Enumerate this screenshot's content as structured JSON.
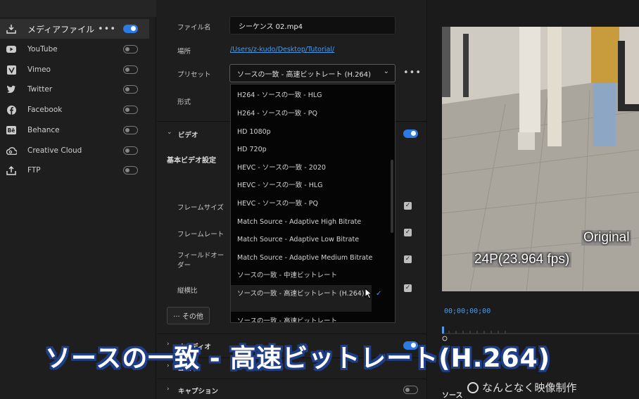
{
  "destinations": [
    {
      "label": "メディアファイル",
      "icon": "download-icon",
      "on": true,
      "active": true
    },
    {
      "label": "YouTube",
      "icon": "youtube-icon",
      "on": false
    },
    {
      "label": "Vimeo",
      "icon": "vimeo-icon",
      "on": false
    },
    {
      "label": "Twitter",
      "icon": "twitter-icon",
      "on": false
    },
    {
      "label": "Facebook",
      "icon": "facebook-icon",
      "on": false
    },
    {
      "label": "Behance",
      "icon": "behance-icon",
      "on": false
    },
    {
      "label": "Creative Cloud",
      "icon": "creative-cloud-icon",
      "on": false
    },
    {
      "label": "FTP",
      "icon": "upload-icon",
      "on": false
    }
  ],
  "more_label": "•••",
  "settings": {
    "filename_label": "ファイル名",
    "filename_value": "シーケンス 02.mp4",
    "location_label": "場所",
    "location_value": "/Users/z-kudo/Desktop/Tutorial/",
    "preset_label": "プリセット",
    "preset_value": "ソースの一致 - 高速ビットレート (H.264)",
    "format_label": "形式",
    "video_section": "ビデオ",
    "basic_video": "基本ビデオ設定",
    "frame_size": "フレームサイズ",
    "frame_rate": "フレームレート",
    "field_order": "フィールドオーダー",
    "aspect": "縦横比",
    "other_button": "··· その他",
    "audio_section": "オーディオ",
    "subtitle_section": "ユ…サ",
    "caption_section": "キャプション"
  },
  "preset_options": [
    "H264 - ソースの一致 - HLG",
    "H264 - ソースの一致 - PQ",
    "HD 1080p",
    "HD 720p",
    "HEVC - ソースの一致 - 2020",
    "HEVC - ソースの一致 - HLG",
    "HEVC - ソースの一致 - PQ",
    "Match Source - Adaptive High Bitrate",
    "Match Source - Adaptive Low Bitrate",
    "Match Source - Adaptive Medium Bitrate",
    "ソースの一致 - 中速ビットレート",
    "ソースの一致 - 高速ビットレート (H.264)",
    "ソースの一致 - 高速ビットレート"
  ],
  "selected_index": 11,
  "preview": {
    "label_original": "Original",
    "label_fps": "24P(23.964 fps)",
    "timecode": "00;00;00;00",
    "source_label": "ソース"
  },
  "caption": "ソースの一致 - 高速ビットレート(H.264)",
  "watermark": "なんとなく映像制作",
  "colors": {
    "accent": "#2c7be5",
    "link": "#4d9be6",
    "caption_outline": "#1f3e86"
  }
}
